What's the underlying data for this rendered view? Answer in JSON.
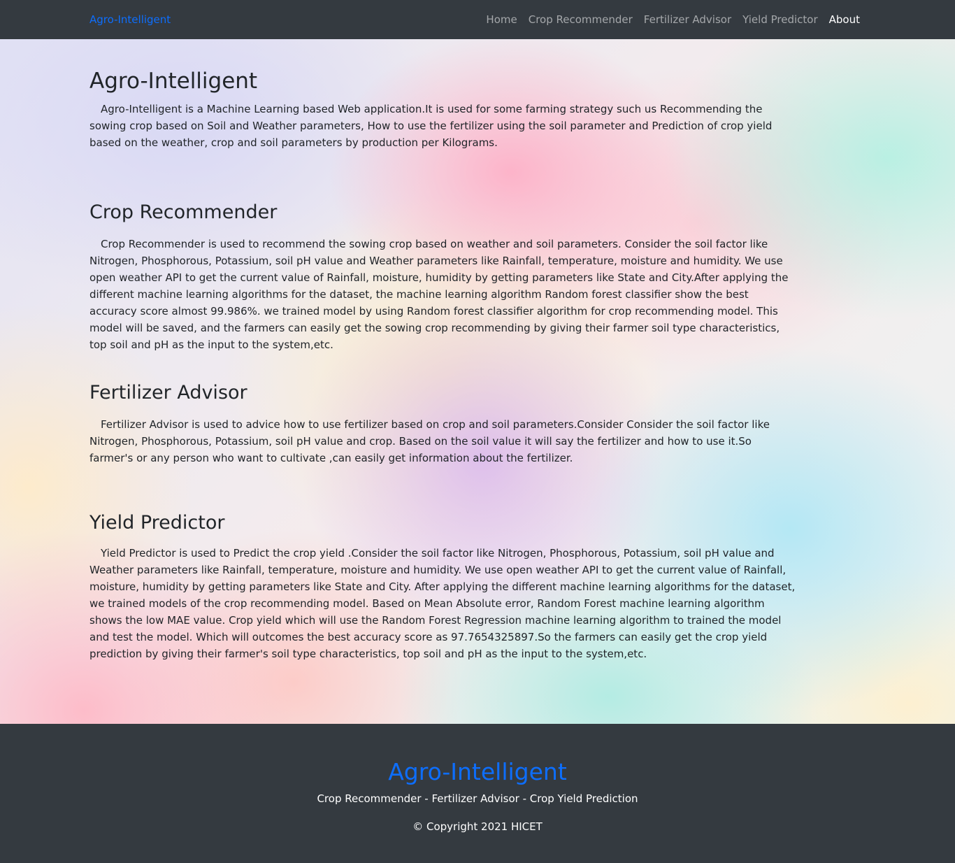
{
  "navbar": {
    "brand": "Agro-Intelligent",
    "links": [
      {
        "label": "Home",
        "active": false
      },
      {
        "label": "Crop Recommender",
        "active": false
      },
      {
        "label": "Fertilizer Advisor",
        "active": false
      },
      {
        "label": "Yield Predictor",
        "active": false
      },
      {
        "label": "About",
        "active": true
      }
    ]
  },
  "main": {
    "intro": {
      "title": "Agro-Intelligent",
      "text": "Agro-Intelligent is a Machine Learning based Web application.It is used for some farming strategy such us Recommending the sowing crop based on Soil and Weather parameters, How to use the fertilizer using the soil parameter and Prediction of crop yield based on the weather, crop and soil parameters by production per Kilograms."
    },
    "crop_recommender": {
      "title": "Crop Recommender",
      "text": "Crop Recommender is used to recommend the sowing crop based on weather and soil parameters. Consider the soil factor like Nitrogen, Phosphorous, Potassium, soil pH value and Weather parameters like Rainfall, temperature, moisture and humidity. We use open weather API to get the current value of Rainfall, moisture, humidity by getting parameters like State and City.After applying the different machine learning algorithms for the dataset, the machine learning algorithm Random forest classifier show the best accuracy score almost 99.986%. we trained model by using Random forest classifier algorithm for crop recommending model. This model will be saved, and the farmers can easily get the sowing crop recommending by giving their farmer soil type characteristics, top soil and pH as the input to the system,etc."
    },
    "fertilizer_advisor": {
      "title": "Fertilizer Advisor",
      "text": "Fertilizer Advisor is used to advice how to use fertilizer based on crop and soil parameters.Consider Consider the soil factor like Nitrogen, Phosphorous, Potassium, soil pH value and crop. Based on the soil value it will say the fertilizer and how to use it.So farmer's or any person who want to cultivate ,can easily get information about the fertilizer."
    },
    "yield_predictor": {
      "title": "Yield Predictor",
      "text": "Yield Predictor is used to Predict the crop yield .Consider the soil factor like Nitrogen, Phosphorous, Potassium, soil pH value and Weather parameters like Rainfall, temperature, moisture and humidity. We use open weather API to get the current value of Rainfall, moisture, humidity by getting parameters like State and City. After applying the different machine learning algorithms for the dataset, we trained models of the crop recommending model. Based on Mean Absolute error, Random Forest machine learning algorithm shows the low MAE value. Crop yield which will use the Random Forest Regression machine learning algorithm to trained the model and test the model. Which will outcomes the best accuracy score as 97.7654325897.So the farmers can easily get the crop yield prediction by giving their farmer's soil type characteristics, top soil and pH as the input to the system,etc."
    }
  },
  "footer": {
    "title": "Agro-Intelligent",
    "subtitle": "Crop Recommender - Fertilizer Advisor - Crop Yield Prediction",
    "copyright": "© Copyright 2021 HICET"
  },
  "colors": {
    "navbar_bg": "#343a40",
    "brand": "#0d6efd",
    "nav_link": "#9a9da0",
    "nav_link_active": "#ffffff",
    "text": "#212529"
  }
}
